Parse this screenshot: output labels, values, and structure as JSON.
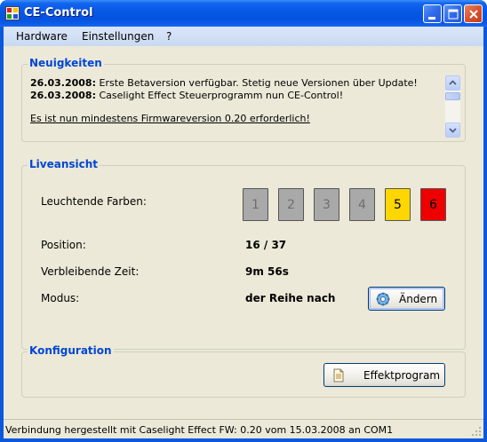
{
  "window": {
    "title": "CE-Control"
  },
  "menu": {
    "items": [
      "Hardware",
      "Einstellungen",
      "?"
    ]
  },
  "news": {
    "title": "Neuigkeiten",
    "entries": [
      {
        "date": "26.03.2008:",
        "text": " Erste Betaversion verfügbar. Stetig neue Versionen über Update!"
      },
      {
        "date": "26.03.2008:",
        "text": " Caselight Effect Steuerprogramm nun CE-Control!"
      }
    ],
    "notice": "Es ist nun mindestens Firmwareversion 0.20 erforderlich!"
  },
  "live": {
    "title": "Liveansicht",
    "colors_label": "Leuchtende Farben:",
    "colors": [
      {
        "label": "1",
        "active": false,
        "fill": "#A9A9A9",
        "text_color": "#6E6E6E"
      },
      {
        "label": "2",
        "active": false,
        "fill": "#A9A9A9",
        "text_color": "#6E6E6E"
      },
      {
        "label": "3",
        "active": false,
        "fill": "#A9A9A9",
        "text_color": "#6E6E6E"
      },
      {
        "label": "4",
        "active": false,
        "fill": "#A9A9A9",
        "text_color": "#6E6E6E"
      },
      {
        "label": "5",
        "active": true,
        "fill": "#FFD700",
        "text_color": "#000000"
      },
      {
        "label": "6",
        "active": true,
        "fill": "#EE0000",
        "text_color": "#000000"
      }
    ],
    "position_label": "Position:",
    "position_value": "16 / 37",
    "time_label": "Verbleibende Zeit:",
    "time_value": "9m 56s",
    "mode_label": "Modus:",
    "mode_value": "der Reihe nach",
    "change_button": "Ändern"
  },
  "config": {
    "title": "Konfiguration",
    "effect_button": "Effektprogram"
  },
  "status": {
    "text": "Verbindung hergestellt mit Caselight Effect FW: 0.20 vom 15.03.2008 an COM1"
  },
  "colors": {
    "titlebar": "#0A59DB",
    "group_title": "#0046D5",
    "face": "#ECE9D8"
  }
}
